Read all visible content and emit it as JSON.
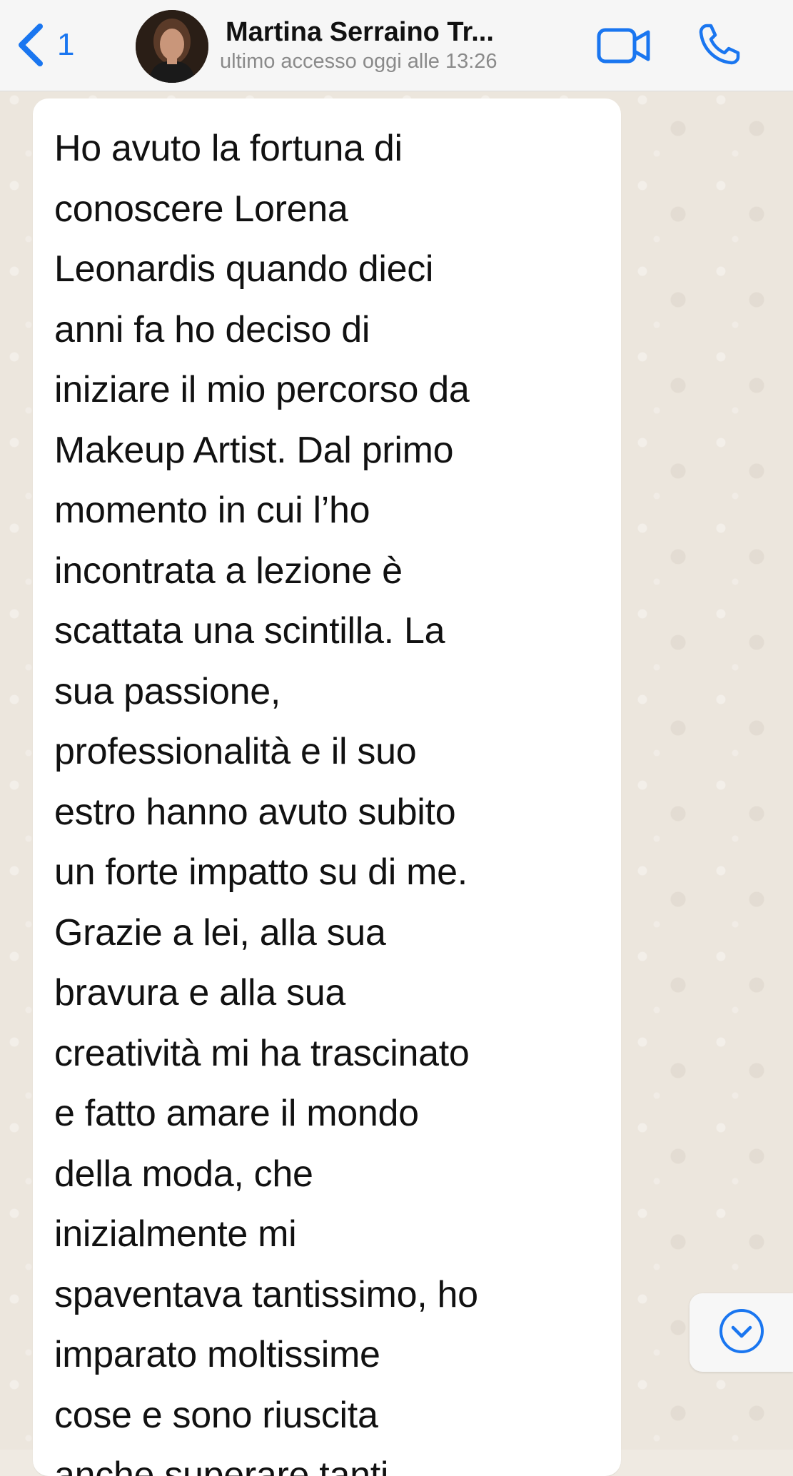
{
  "header": {
    "back_count": "1",
    "contact_name": "Martina Serraino Tr...",
    "status": "ultimo accesso oggi alle 13:26",
    "icons": {
      "back": "chevron-left-icon",
      "video": "video-camera-icon",
      "call": "phone-icon"
    },
    "accent_color": "#1a76f0"
  },
  "message": {
    "text": "Ho avuto la fortuna di\nconoscere Lorena\nLeonardis quando dieci\nanni fa ho deciso di\niniziare il mio percorso da\nMakeup Artist. Dal primo\nmomento in cui l’ho\nincontrata a lezione è\nscattata una scintilla. La\nsua passione,\nprofessionalità e il suo\nestro hanno avuto subito\nun forte impatto su di me.\nGrazie a lei, alla sua\nbravura e alla sua\ncreatività mi ha trascinato\ne fatto amare il mondo\ndella moda, che\ninizialmente mi\nspaventava tantissimo, ho\nimparato moltissime\ncose e sono riuscita\nanche superare tanti"
  },
  "scroll_button": {
    "icon": "chevron-down-circle-icon"
  }
}
